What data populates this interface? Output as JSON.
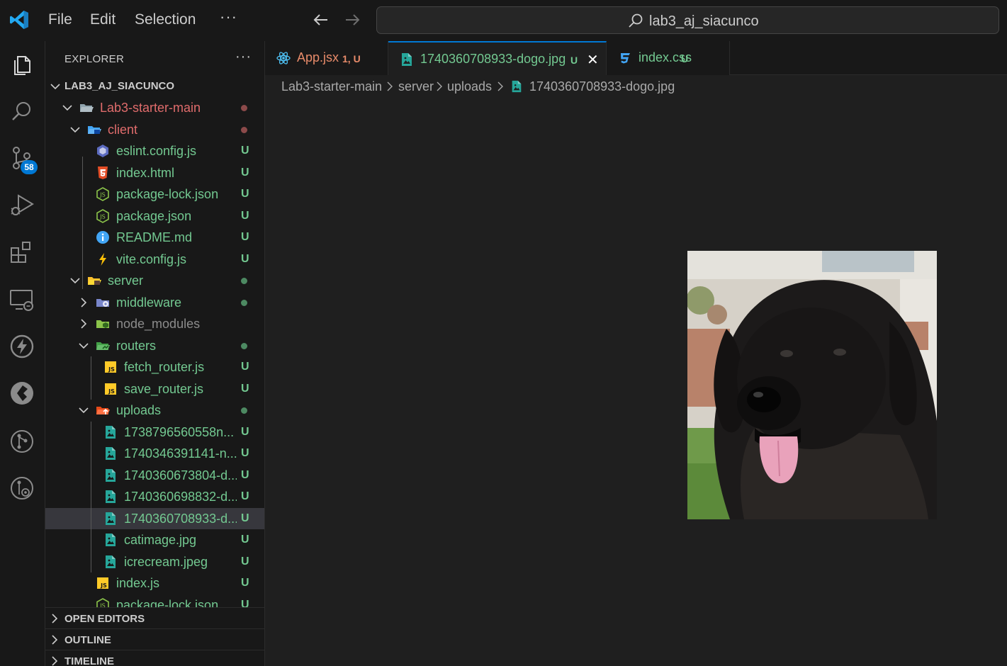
{
  "titlebar": {
    "menu": [
      "File",
      "Edit",
      "Selection"
    ],
    "more": "···",
    "search_text": "lab3_aj_siacunco"
  },
  "activity": {
    "items": [
      "explorer-icon",
      "search-icon",
      "source-control-icon",
      "run-debug-icon",
      "extensions-icon",
      "remote-explorer-icon",
      "thunder-client-icon",
      "docker-icon",
      "git-graph-icon",
      "gitlens-icon"
    ],
    "scm_badge": "58"
  },
  "sidebar": {
    "title": "EXPLORER",
    "more": "···",
    "root_label": "LAB3_AJ_SIACUNCO",
    "tree": [
      {
        "label": "Lab3-starter-main",
        "kind": "folder-open",
        "depth": 1,
        "color": "#e06c6c",
        "dot": "#8c4a4a"
      },
      {
        "label": "client",
        "kind": "folder-open-client",
        "depth": 2,
        "color": "#e06c6c",
        "dot": "#8c4a4a"
      },
      {
        "label": "eslint.config.js",
        "kind": "eslint",
        "depth": 3,
        "color": "#73c991",
        "status": "U"
      },
      {
        "label": "index.html",
        "kind": "html",
        "depth": 3,
        "color": "#73c991",
        "status": "U"
      },
      {
        "label": "package-lock.json",
        "kind": "node",
        "depth": 3,
        "color": "#73c991",
        "status": "U"
      },
      {
        "label": "package.json",
        "kind": "node",
        "depth": 3,
        "color": "#73c991",
        "status": "U"
      },
      {
        "label": "README.md",
        "kind": "info",
        "depth": 3,
        "color": "#73c991",
        "status": "U"
      },
      {
        "label": "vite.config.js",
        "kind": "vite",
        "depth": 3,
        "color": "#73c991",
        "status": "U"
      },
      {
        "label": "server",
        "kind": "folder-open-server",
        "depth": 2,
        "color": "#73c991",
        "dot": "#4d8a62"
      },
      {
        "label": "middleware",
        "kind": "folder-middleware",
        "depth": 3,
        "color": "#73c991",
        "dot": "#4d8a62",
        "collapsed": true
      },
      {
        "label": "node_modules",
        "kind": "folder-node",
        "depth": 3,
        "color": "#8c8c8c",
        "collapsed": true
      },
      {
        "label": "routers",
        "kind": "folder-routers",
        "depth": 3,
        "color": "#73c991",
        "dot": "#4d8a62"
      },
      {
        "label": "fetch_router.js",
        "kind": "js",
        "depth": 4,
        "color": "#73c991",
        "status": "U"
      },
      {
        "label": "save_router.js",
        "kind": "js",
        "depth": 4,
        "color": "#73c991",
        "status": "U"
      },
      {
        "label": "uploads",
        "kind": "folder-uploads",
        "depth": 3,
        "color": "#73c991",
        "dot": "#4d8a62"
      },
      {
        "label": "1738796560558n...",
        "kind": "image",
        "depth": 4,
        "color": "#73c991",
        "status": "U"
      },
      {
        "label": "1740346391141-n...",
        "kind": "image",
        "depth": 4,
        "color": "#73c991",
        "status": "U"
      },
      {
        "label": "1740360673804-d...",
        "kind": "image",
        "depth": 4,
        "color": "#73c991",
        "status": "U"
      },
      {
        "label": "1740360698832-d...",
        "kind": "image",
        "depth": 4,
        "color": "#73c991",
        "status": "U"
      },
      {
        "label": "1740360708933-d...",
        "kind": "image",
        "depth": 4,
        "color": "#73c991",
        "status": "U",
        "selected": true
      },
      {
        "label": "catimage.jpg",
        "kind": "image",
        "depth": 4,
        "color": "#73c991",
        "status": "U"
      },
      {
        "label": "icrecream.jpeg",
        "kind": "image",
        "depth": 4,
        "color": "#73c991",
        "status": "U"
      },
      {
        "label": "index.js",
        "kind": "js",
        "depth": 3,
        "color": "#73c991",
        "status": "U"
      },
      {
        "label": "package-lock.json",
        "kind": "node",
        "depth": 3,
        "color": "#73c991",
        "status": "U"
      }
    ],
    "panels": [
      "OPEN EDITORS",
      "OUTLINE",
      "TIMELINE"
    ]
  },
  "tabs": [
    {
      "label": "App.jsx",
      "meta": "1, U",
      "kind": "react",
      "color": "#e88b6a",
      "meta_color": "#e88b6a"
    },
    {
      "label": "1740360708933-dogo.jpg",
      "meta": "U",
      "kind": "image",
      "color": "#73c991",
      "meta_color": "#73c991",
      "active": true,
      "close": "✕"
    },
    {
      "label": "index.css",
      "meta": "U",
      "kind": "css",
      "color": "#73c991",
      "meta_color": "#73c991"
    }
  ],
  "breadcrumb": [
    "Lab3-starter-main",
    "server",
    "uploads",
    "1740360708933-dogo.jpg"
  ],
  "colors": {
    "accent": "#0078d4",
    "untracked": "#73c991",
    "error": "#e06c6c"
  }
}
